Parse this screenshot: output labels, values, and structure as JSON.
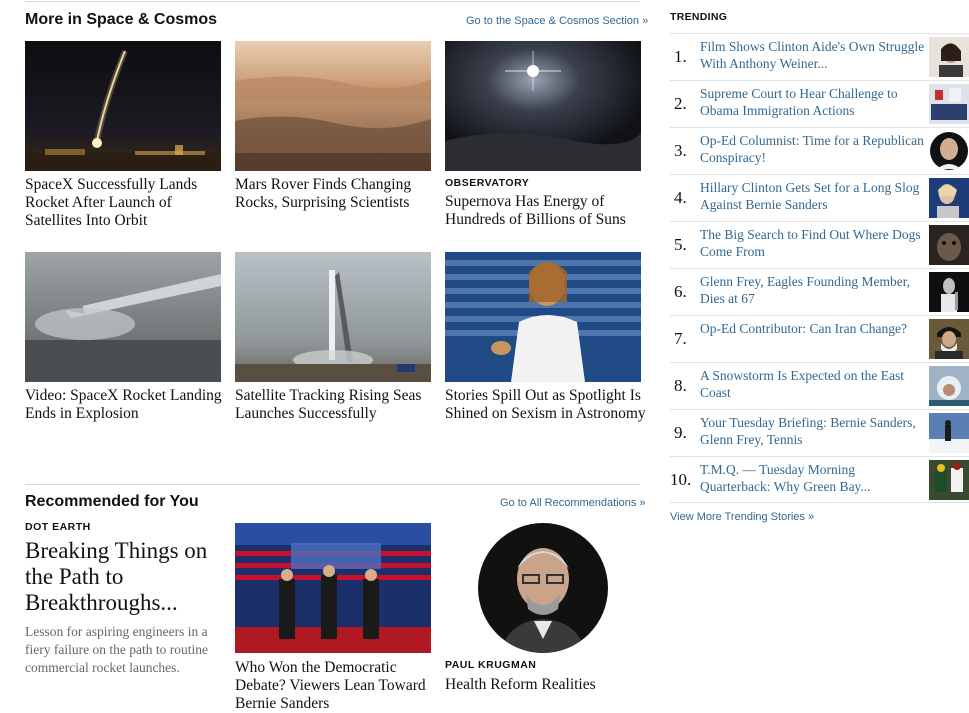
{
  "space_section": {
    "title": "More in Space & Cosmos",
    "link": "Go to the Space & Cosmos Section »",
    "stories": [
      {
        "headline": "SpaceX Successfully Lands Rocket After Launch of Satellites Into Orbit",
        "kicker": "",
        "image": "rocket-launch-night"
      },
      {
        "headline": "Mars Rover Finds Changing Rocks, Surprising Scientists",
        "kicker": "",
        "image": "mars-landscape"
      },
      {
        "headline": "Supernova Has Energy of Hundreds of Billions of Suns",
        "kicker": "OBSERVATORY",
        "image": "supernova-space"
      },
      {
        "headline": "Video: SpaceX Rocket Landing Ends in Explosion",
        "kicker": "",
        "image": "rocket-landing-fog"
      },
      {
        "headline": "Satellite Tracking Rising Seas Launches Successfully",
        "kicker": "",
        "image": "launch-pad-tower"
      },
      {
        "headline": "Stories Spill Out as Spotlight Is Shined on Sexism in Astronomy",
        "kicker": "",
        "image": "face-the-nation-interview"
      }
    ]
  },
  "recommended": {
    "title": "Recommended for You",
    "link": "Go to All Recommendations »",
    "lead": {
      "kicker": "DOT EARTH",
      "headline": "Breaking Things on the Path to Breakthroughs...",
      "summary": "Lesson for aspiring engineers in a fiery failure on the path to routine commercial rocket launches."
    },
    "middle": {
      "headline": "Who Won the Democratic Debate? Viewers Lean Toward Bernie Sanders",
      "image": "democratic-debate-stage"
    },
    "right": {
      "kicker": "PAUL KRUGMAN",
      "headline": "Health Reform Realities",
      "image": "krugman-portrait"
    }
  },
  "trending": {
    "label": "TRENDING",
    "items": [
      {
        "num": "1.",
        "title": "Film Shows Clinton Aide's Own Struggle With Anthony Weiner..."
      },
      {
        "num": "2.",
        "title": "Supreme Court to Hear Challenge to Obama Immigration Actions"
      },
      {
        "num": "3.",
        "title": "Op-Ed Columnist: Time for a Republican Conspiracy!"
      },
      {
        "num": "4.",
        "title": "Hillary Clinton Gets Set for a Long Slog Against Bernie Sanders"
      },
      {
        "num": "5.",
        "title": "The Big Search to Find Out Where Dogs Come From"
      },
      {
        "num": "6.",
        "title": "Glenn Frey,  Eagles Founding Member, Dies at 67"
      },
      {
        "num": "7.",
        "title": "Op-Ed Contributor: Can Iran Change?"
      },
      {
        "num": "8.",
        "title": "A Snowstorm Is Expected on the East Coast"
      },
      {
        "num": "9.",
        "title": "Your Tuesday Briefing: Bernie Sanders, Glenn Frey, Tennis"
      },
      {
        "num": "10.",
        "title": "T.M.Q. — Tuesday Morning Quarterback: Why Green Bay..."
      }
    ],
    "more": "View More Trending Stories »"
  },
  "colors": {
    "link": "#326891",
    "rule": "#d8d8d8",
    "text": "#111111",
    "summary": "#666666"
  }
}
